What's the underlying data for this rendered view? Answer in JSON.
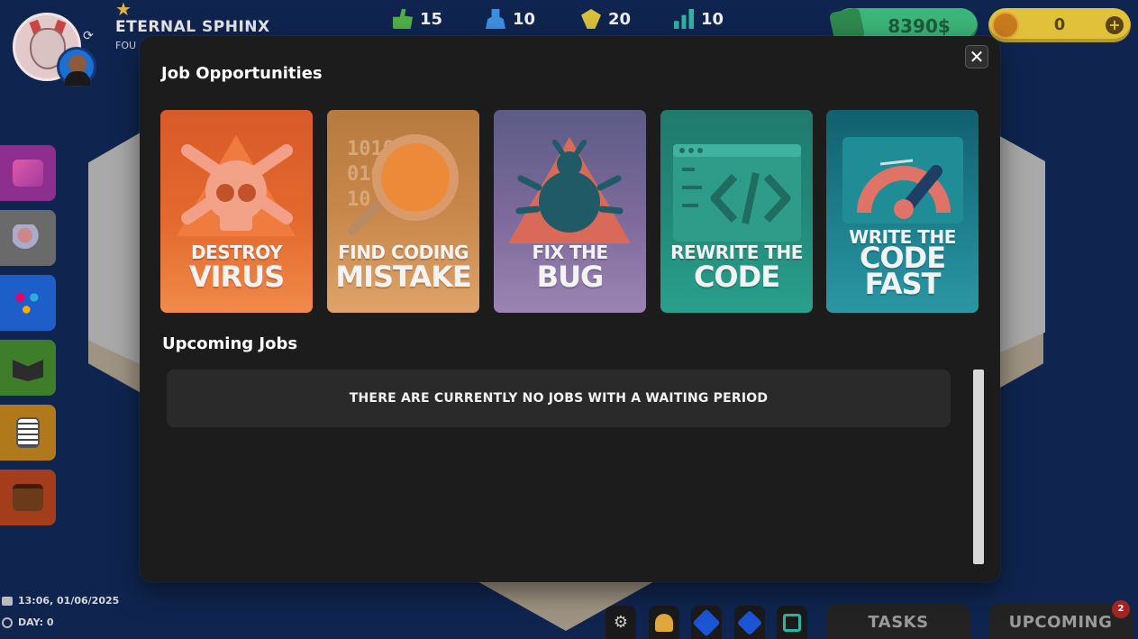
{
  "player": {
    "name": "ETERNAL SPHINX",
    "subtitle": "FOU"
  },
  "stats": [
    {
      "icon": "thumbs-up-icon",
      "value": "15",
      "color": "#4fb045"
    },
    {
      "icon": "people-icon",
      "value": "10",
      "color": "#3d8fe0"
    },
    {
      "icon": "handshake-icon",
      "value": "20",
      "color": "#d9c03b"
    },
    {
      "icon": "bar-chart-icon",
      "value": "10",
      "color": "#2fb3a3"
    }
  ],
  "currency": {
    "money": "8390$",
    "gold": "0",
    "money_color": "#3cb57a",
    "gold_color": "#e2c13a"
  },
  "modal": {
    "title": "Job Opportunities",
    "close_symbol": "✕",
    "upcoming_title": "Upcoming Jobs",
    "empty_message": "THERE ARE CURRENTLY NO JOBS WITH A WAITING PERIOD",
    "jobs": [
      {
        "line1": "DESTROY",
        "line2": "VIRUS",
        "icon": "skull-crossbones-icon",
        "color": "#e0612e"
      },
      {
        "line1": "FIND CODING",
        "line2": "MISTAKE",
        "icon": "magnifier-binary-icon",
        "color": "#c8874a"
      },
      {
        "line1": "FIX THE",
        "line2": "BUG",
        "icon": "bug-warning-icon",
        "color": "#7e6b9c"
      },
      {
        "line1": "REWRITE THE",
        "line2": "CODE",
        "icon": "code-brackets-icon",
        "color": "#238a7a"
      },
      {
        "line1": "WRITE THE",
        "line2": "CODE FAST",
        "icon": "speedometer-rocket-icon",
        "color": "#1e7f8c"
      }
    ]
  },
  "sidebar": [
    {
      "name": "cube-icon",
      "color": "#8e2f8f"
    },
    {
      "name": "hire-search-icon",
      "color": "#6a6a6a"
    },
    {
      "name": "team-tree-icon",
      "color": "#1d5ec9"
    },
    {
      "name": "wallet-icon",
      "color": "#3e7d2a"
    },
    {
      "name": "clipboard-icon",
      "color": "#b07a1c"
    },
    {
      "name": "briefcase-icon",
      "color": "#a33d1b"
    }
  ],
  "footer": {
    "datetime": "13:06, 01/06/2025",
    "day": "DAY: 0",
    "tasks_label": "TASKS",
    "upcoming_label": "UPCOMING",
    "upcoming_badge": "2"
  }
}
